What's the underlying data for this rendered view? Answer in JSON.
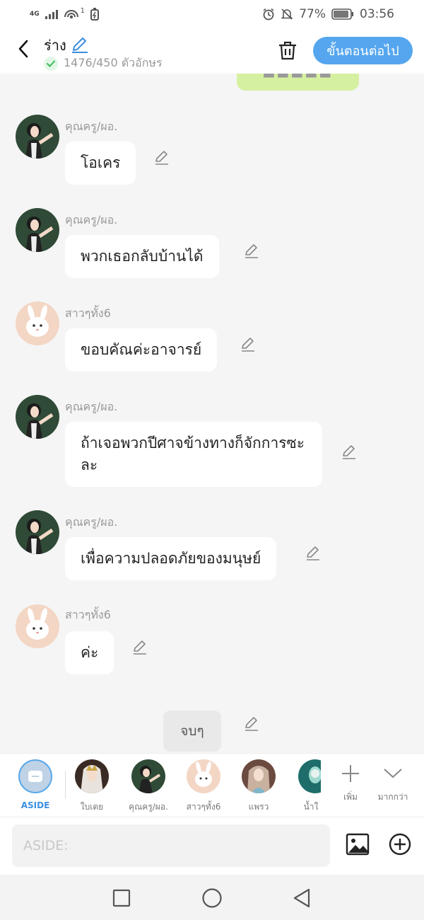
{
  "status_bar": {
    "network": "4G",
    "hotspot_count": "1",
    "battery": "77%",
    "time": "03:56"
  },
  "header": {
    "title": "ร่าง",
    "char_count": "1476/450 ตัวอักษร",
    "next_button": "ขั้นตอนต่อไป"
  },
  "messages": [
    {
      "sender": "คุณครู/ผอ.",
      "text": "โอเคร",
      "avatar": "teacher"
    },
    {
      "sender": "คุณครู/ผอ.",
      "text": "พวกเธอกลับบ้านได้",
      "avatar": "teacher"
    },
    {
      "sender": "สาวๆทั้ง6",
      "text": "ขอบคัณค่ะอาจารย์",
      "avatar": "girls"
    },
    {
      "sender": "คุณครู/ผอ.",
      "text": "ถ้าเจอพวกปีศาจข้างทางก็จักการซะละ",
      "avatar": "teacher"
    },
    {
      "sender": "คุณครู/ผอ.",
      "text": "เพื่อความปลอดภัยของมนุษย์",
      "avatar": "teacher"
    },
    {
      "sender": "สาวๆทั้ง6",
      "text": "ค่ะ",
      "avatar": "girls"
    }
  ],
  "narration": "จบๆ",
  "characters": [
    {
      "label": "ASIDE",
      "type": "aside"
    },
    {
      "label": "ใบเตย",
      "type": "baitoey"
    },
    {
      "label": "คุณครู/ผอ.",
      "type": "teacher"
    },
    {
      "label": "สาวๆทั้ง6",
      "type": "girls"
    },
    {
      "label": "แพรว",
      "type": "praew"
    },
    {
      "label": "น้ำใ",
      "type": "nam"
    }
  ],
  "tools": {
    "add_label": "เพิ่ม",
    "more_label": "มากกว่า"
  },
  "input": {
    "placeholder": "ASIDE:"
  },
  "colors": {
    "accent": "#55a6ee",
    "green_bubble": "#d6f0a1"
  }
}
